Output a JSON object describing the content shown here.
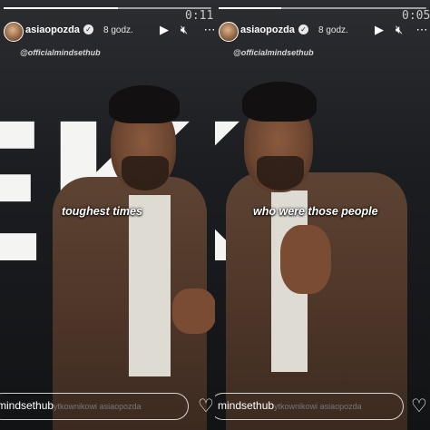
{
  "stories": [
    {
      "username": "asiaopozda",
      "time_ago": "8 godz.",
      "timecode": "0:11",
      "source_handle": "@officialmindsethub",
      "caption": "toughest times",
      "reply_placeholder": "mindsethub",
      "reply_hint": "ytkownikowi asiaopozda",
      "progress": 0.55
    },
    {
      "username": "asiaopozda",
      "time_ago": "8 godz.",
      "timecode": "0:05",
      "source_handle": "@officialmindsethub",
      "caption": "who were those people",
      "reply_placeholder": "mindsethub",
      "reply_hint": "ytkownikowi asiaopozda",
      "progress": 0.3
    }
  ],
  "icons": {
    "play": "play-icon",
    "mute": "speaker-muted-icon",
    "more": "more-icon",
    "like": "heart-icon",
    "verified": "verified-badge-icon"
  }
}
